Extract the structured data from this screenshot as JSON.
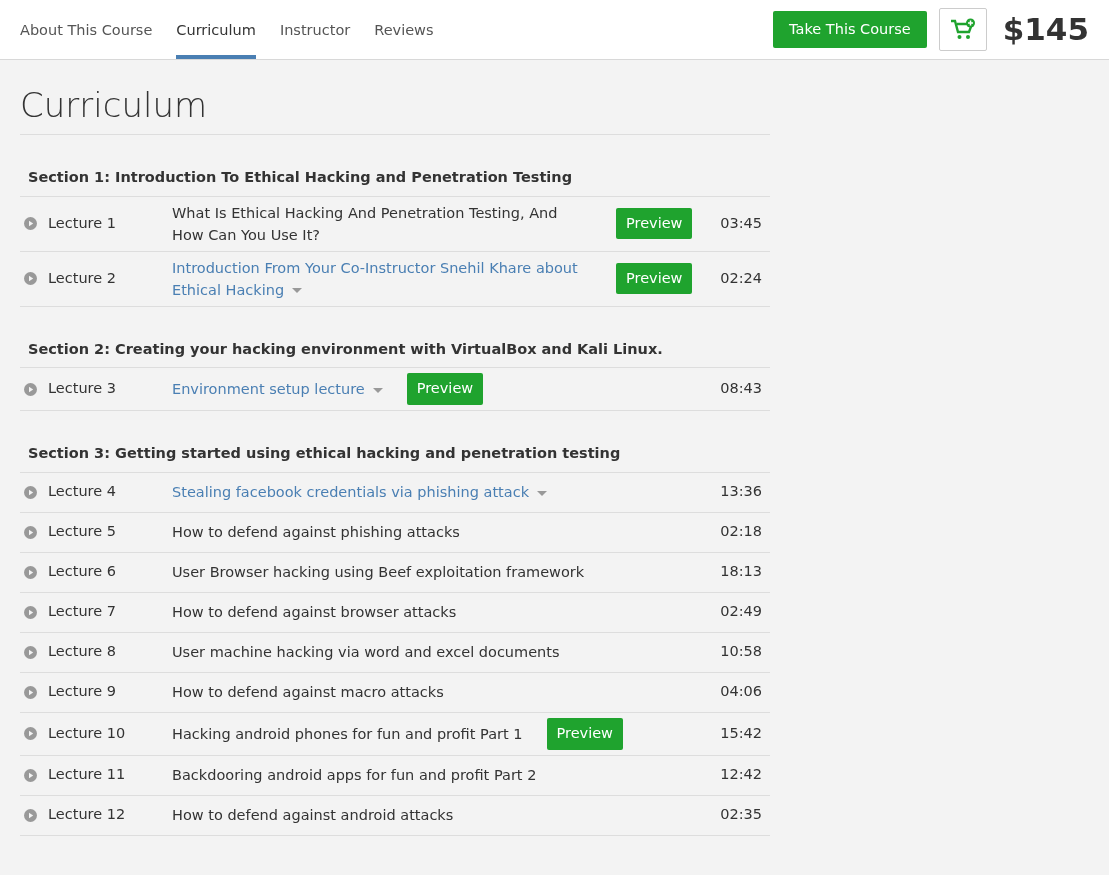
{
  "tabs": [
    {
      "label": "About This Course",
      "selected": false
    },
    {
      "label": "Curriculum",
      "selected": true
    },
    {
      "label": "Instructor",
      "selected": false
    },
    {
      "label": "Reviews",
      "selected": false
    }
  ],
  "take_course_button": "Take This Course",
  "price": "$145",
  "heading": "Curriculum",
  "sections": [
    {
      "title": "Section 1: Introduction To Ethical Hacking and Penetration Testing",
      "lectures": [
        {
          "number": "Lecture 1",
          "title": "What Is Ethical Hacking And Penetration Testing, And How Can You Use It?",
          "expandable": false,
          "preview": "Preview",
          "duration": "03:45"
        },
        {
          "number": "Lecture 2",
          "title": "Introduction From Your Co-Instructor Snehil Khare about Ethical Hacking",
          "expandable": true,
          "preview": "Preview",
          "duration": "02:24"
        }
      ]
    },
    {
      "title": "Section 2: Creating your hacking environment with VirtualBox and Kali Linux.",
      "lectures": [
        {
          "number": "Lecture 3",
          "title": "Environment setup lecture",
          "expandable": true,
          "preview": "Preview",
          "duration": "08:43"
        }
      ]
    },
    {
      "title": "Section 3: Getting started using ethical hacking and penetration testing",
      "lectures": [
        {
          "number": "Lecture 4",
          "title": "Stealing facebook credentials via phishing attack",
          "expandable": true,
          "duration": "13:36"
        },
        {
          "number": "Lecture 5",
          "title": "How to defend against phishing attacks",
          "expandable": false,
          "duration": "02:18"
        },
        {
          "number": "Lecture 6",
          "title": "User Browser hacking using Beef exploitation framework",
          "expandable": false,
          "duration": "18:13"
        },
        {
          "number": "Lecture 7",
          "title": "How to defend against browser attacks",
          "expandable": false,
          "duration": "02:49"
        },
        {
          "number": "Lecture 8",
          "title": "User machine hacking via word and excel documents",
          "expandable": false,
          "duration": "10:58"
        },
        {
          "number": "Lecture 9",
          "title": "How to defend against macro attacks",
          "expandable": false,
          "duration": "04:06"
        },
        {
          "number": "Lecture 10",
          "title": "Hacking android phones for fun and profit Part 1",
          "expandable": false,
          "preview": "Preview",
          "duration": "15:42"
        },
        {
          "number": "Lecture 11",
          "title": "Backdooring android apps for fun and profit Part 2",
          "expandable": false,
          "duration": "12:42"
        },
        {
          "number": "Lecture 12",
          "title": "How to defend against android attacks",
          "expandable": false,
          "duration": "02:35"
        }
      ]
    }
  ]
}
